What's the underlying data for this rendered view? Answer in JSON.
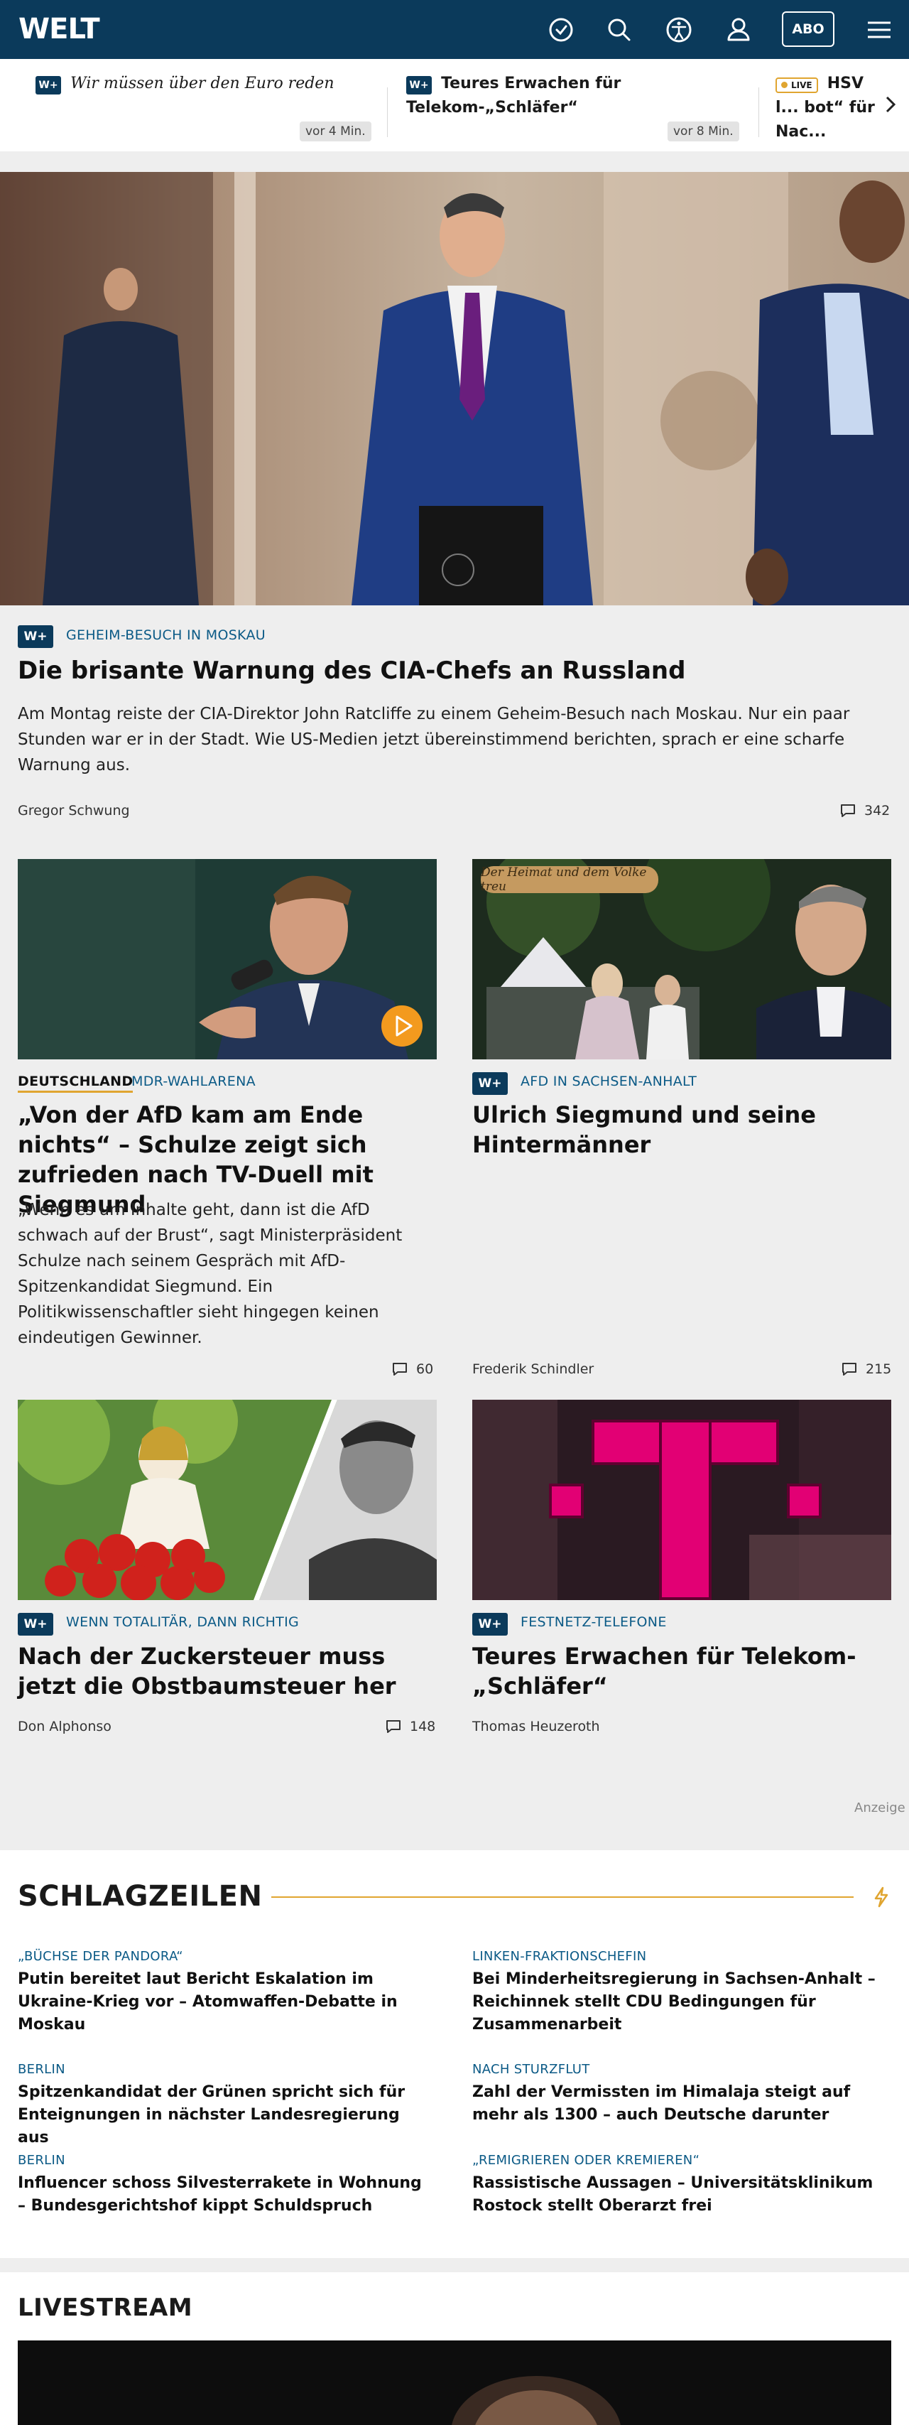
{
  "header": {
    "logo": "WELT",
    "icons": [
      "clock-icon",
      "search-icon",
      "accessibility-icon",
      "user-icon"
    ],
    "abo_label": "ABO",
    "menu_icon": "hamburger-icon"
  },
  "ticker": [
    {
      "badge": "W+",
      "title": "Wir müssen über den Euro reden",
      "time": "vor 4 Min."
    },
    {
      "badge": "W+",
      "title": "Teures Erwachen für Telekom-„Schläfer“",
      "time": "vor 8 Min."
    },
    {
      "badge": "LIVE",
      "title": "HSV l... bot“ für Nac..."
    }
  ],
  "hero": {
    "badge": "W+",
    "kicker": "GEHEIM-BESUCH IN MOSKAU",
    "title": "Die brisante Warnung des CIA-Chefs an Russland",
    "teaser": "Am Montag reiste der CIA-Direktor John Ratcliffe zu einem Geheim-Besuch nach Moskau. Nur ein paar Stunden war er in der Stadt. Wie US-Medien jetzt übereinstimmend berichten, sprach er eine scharfe Warnung aus.",
    "author": "Gregor Schwung",
    "comments": "342"
  },
  "articles": [
    {
      "section": "DEUTSCHLAND",
      "kicker": "MDR-WAHLARENA",
      "title": "„Von der AfD kam am Ende nichts“ – Schulze zeigt sich zufrieden nach TV-Duell mit Siegmund",
      "teaser": "„Wenn es um Inhalte geht, dann ist die AfD schwach auf der Brust“, sagt Ministerpräsident Schulze nach seinem Gespräch mit AfD-Spitzenkandidat Siegmund. Ein Politikwissenschaftler sieht hingegen keinen eindeutigen Gewinner.",
      "author": "",
      "comments": "60"
    },
    {
      "badge": "W+",
      "kicker": "AFD IN SACHSEN-ANHALT",
      "title": "Ulrich Siegmund und seine Hintermänner",
      "image_banner": "Der Heimat und dem Volke treu",
      "author": "Frederik Schindler",
      "comments": "215"
    },
    {
      "badge": "W+",
      "kicker": "WENN TOTALITÄR, DANN RICHTIG",
      "title": "Nach der Zuckersteuer muss jetzt die Obstbaumsteuer her",
      "author": "Don Alphonso",
      "comments": "148"
    },
    {
      "badge": "W+",
      "kicker": "FESTNETZ-TELEFONE",
      "title": "Teures Erwachen für Telekom-„Schläfer“",
      "author": "Thomas Heuzeroth",
      "comments": ""
    }
  ],
  "ad_label": "Anzeige",
  "schlagzeilen": {
    "title": "SCHLAGZEILEN",
    "items": [
      {
        "kicker": "„BÜCHSE DER PANDORA“",
        "title": "Putin bereitet laut Bericht Eskalation im Ukraine-Krieg vor – Atomwaffen-Debatte in Moskau"
      },
      {
        "kicker": "LINKEN-FRAKTIONSCHEFIN",
        "title": "Bei Minderheitsregierung in Sachsen-Anhalt – Reichinnek stellt CDU Bedingungen für Zusammenarbeit"
      },
      {
        "kicker": "BERLIN",
        "title": "Spitzenkandidat der Grünen spricht sich für Enteignungen in nächster Landesregierung aus"
      },
      {
        "kicker": "NACH STURZFLUT",
        "title": "Zahl der Vermissten im Himalaja steigt auf mehr als 1300 – auch Deutsche darunter"
      },
      {
        "kicker": "BERLIN",
        "title": "Influencer schoss Silvesterrakete in Wohnung – Bundesgerichtshof kippt Schuldspruch"
      },
      {
        "kicker": "„REMIGRIEREN ODER KREMIEREN“",
        "title": "Rassistische Aussagen – Universitätsklinikum Rostock stellt Oberarzt frei"
      }
    ]
  },
  "livestream": {
    "title": "LIVESTREAM"
  },
  "colors": {
    "brand_navy": "#0b3a5b",
    "kicker_blue": "#0b5a86",
    "accent_gold": "#e0a530",
    "play_orange": "#f39a1e",
    "telekom_magenta": "#e20074"
  }
}
